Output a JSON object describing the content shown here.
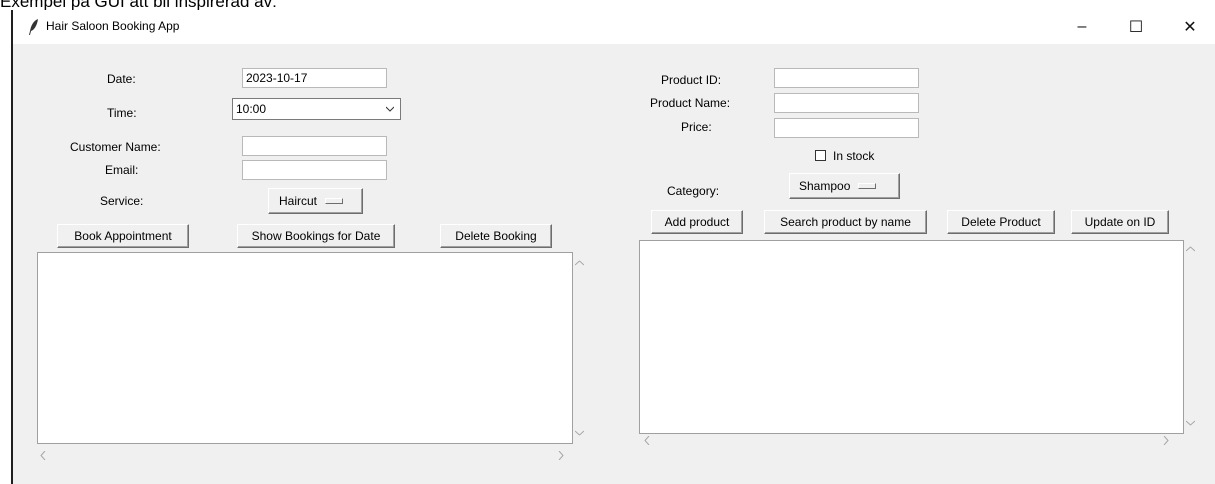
{
  "caption": "Exempel på GUI att bli inspirerad av:",
  "window": {
    "title": "Hair Saloon Booking App",
    "controls": {
      "minimize": "–",
      "maximize": "☐",
      "close": "✕"
    }
  },
  "booking": {
    "date_label": "Date:",
    "date_value": "2023-10-17",
    "time_label": "Time:",
    "time_value": "10:00",
    "customer_name_label": "Customer Name:",
    "customer_name_value": "",
    "email_label": "Email:",
    "email_value": "",
    "service_label": "Service:",
    "service_value": "Haircut",
    "buttons": {
      "book": "Book Appointment",
      "show": "Show Bookings for Date",
      "delete": "Delete Booking"
    }
  },
  "product": {
    "id_label": "Product ID:",
    "id_value": "",
    "name_label": "Product Name:",
    "name_value": "",
    "price_label": "Price:",
    "price_value": "",
    "in_stock_label": "In stock",
    "in_stock_checked": false,
    "category_label": "Category:",
    "category_value": "Shampoo",
    "buttons": {
      "add": "Add product",
      "search": "Search product by name",
      "delete": "Delete Product",
      "update": "Update on ID"
    }
  },
  "icons": {
    "app": "feather-icon",
    "dropdown": "chevron-down-icon",
    "scroll_up": "chevron-up-icon",
    "scroll_down": "chevron-down-icon",
    "scroll_left": "chevron-left-icon",
    "scroll_right": "chevron-right-icon"
  },
  "colors": {
    "window_bg": "#f0f0f0",
    "titlebar_bg": "#ffffff",
    "list_bg": "#ffffff"
  }
}
